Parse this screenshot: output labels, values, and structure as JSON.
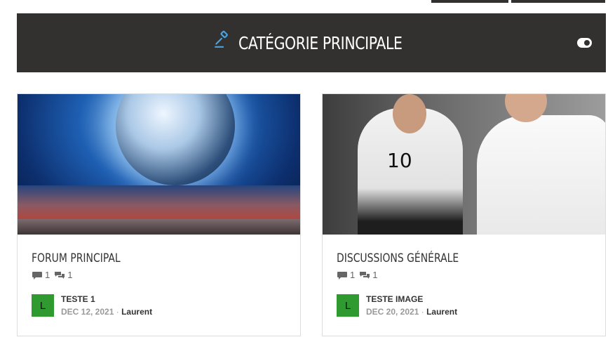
{
  "header": {
    "title": "CATÉGORIE PRINCIPALE",
    "icon": "gavel-icon",
    "accent": "#4aa3df",
    "background": "#333130"
  },
  "forums": [
    {
      "title": "FORUM PRINCIPAL",
      "topics": "1",
      "posts": "1",
      "last_post": {
        "avatar_letter": "L",
        "topic": "TESTE 1",
        "date": "DEC 12, 2021",
        "separator": "·",
        "user": "Laurent"
      }
    },
    {
      "title": "DISCUSSIONS GÉNÉRALE",
      "topics": "1",
      "posts": "1",
      "last_post": {
        "avatar_letter": "L",
        "topic": "TESTE IMAGE",
        "date": "DEC 20, 2021",
        "separator": "·",
        "user": "Laurent"
      }
    }
  ],
  "players_image": {
    "jersey_number": "10"
  }
}
